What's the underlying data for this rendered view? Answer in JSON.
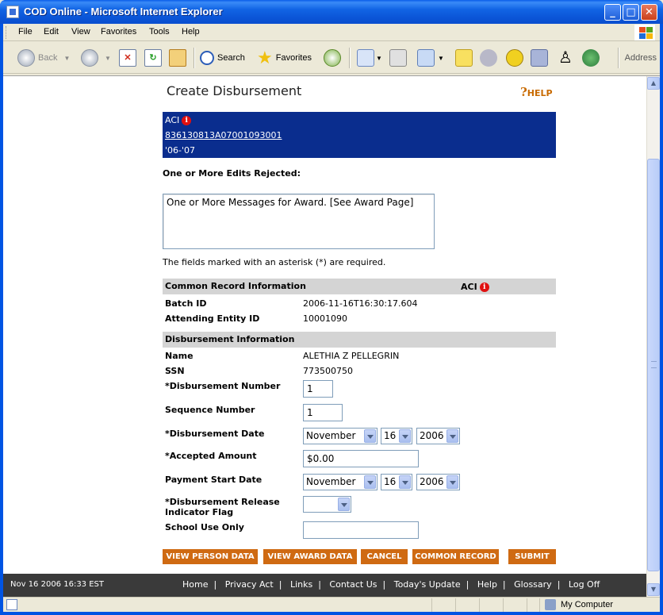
{
  "window": {
    "title": "COD Online - Microsoft Internet Explorer"
  },
  "menu": [
    "File",
    "Edit",
    "View",
    "Favorites",
    "Tools",
    "Help"
  ],
  "toolbar": {
    "back": "Back",
    "search": "Search",
    "favorites": "Favorites",
    "address": "Address"
  },
  "page": {
    "title": "Create Disbursement",
    "help": "HELP",
    "award": {
      "program": "ACI",
      "award_id": "836130813A07001093001",
      "year": "'06-'07"
    },
    "edits_label": "One or More Edits Rejected:",
    "message": "One or More Messages for Award. [See Award Page]",
    "required_note": "The fields marked with an asterisk (*) are required."
  },
  "common_record": {
    "header": "Common Record Information",
    "program": "ACI",
    "batch_id_label": "Batch ID",
    "batch_id": "2006-11-16T16:30:17.604",
    "entity_label": "Attending Entity ID",
    "entity_id": "10001090"
  },
  "disbursement": {
    "header": "Disbursement Information",
    "name_label": "Name",
    "name": "ALETHIA Z PELLEGRIN",
    "ssn_label": "SSN",
    "ssn": "773500750",
    "number_label": "*Disbursement Number",
    "number": "1",
    "sequence_label": "Sequence Number",
    "sequence": "1",
    "date_label": "*Disbursement Date",
    "date_month": "November",
    "date_day": "16",
    "date_year": "2006",
    "amount_label": "*Accepted Amount",
    "amount": "$0.00",
    "payment_label": "Payment Start Date",
    "payment_month": "November",
    "payment_day": "16",
    "payment_year": "2006",
    "release_label_1": "*Disbursement Release",
    "release_label_2": "Indicator Flag",
    "release_value": "",
    "school_label": "School Use Only",
    "school_value": ""
  },
  "buttons": {
    "view_person": "VIEW PERSON DATA",
    "view_award": "VIEW AWARD DATA",
    "cancel": "CANCEL",
    "common_record": "COMMON RECORD",
    "submit": "SUBMIT"
  },
  "footer": {
    "timestamp": "Nov 16 2006 16:33 EST",
    "links": [
      "Home",
      "Privacy Act",
      "Links",
      "Contact Us",
      "Today's Update",
      "Help",
      "Glossary",
      "Log Off"
    ]
  },
  "status": {
    "zone": "My Computer"
  }
}
